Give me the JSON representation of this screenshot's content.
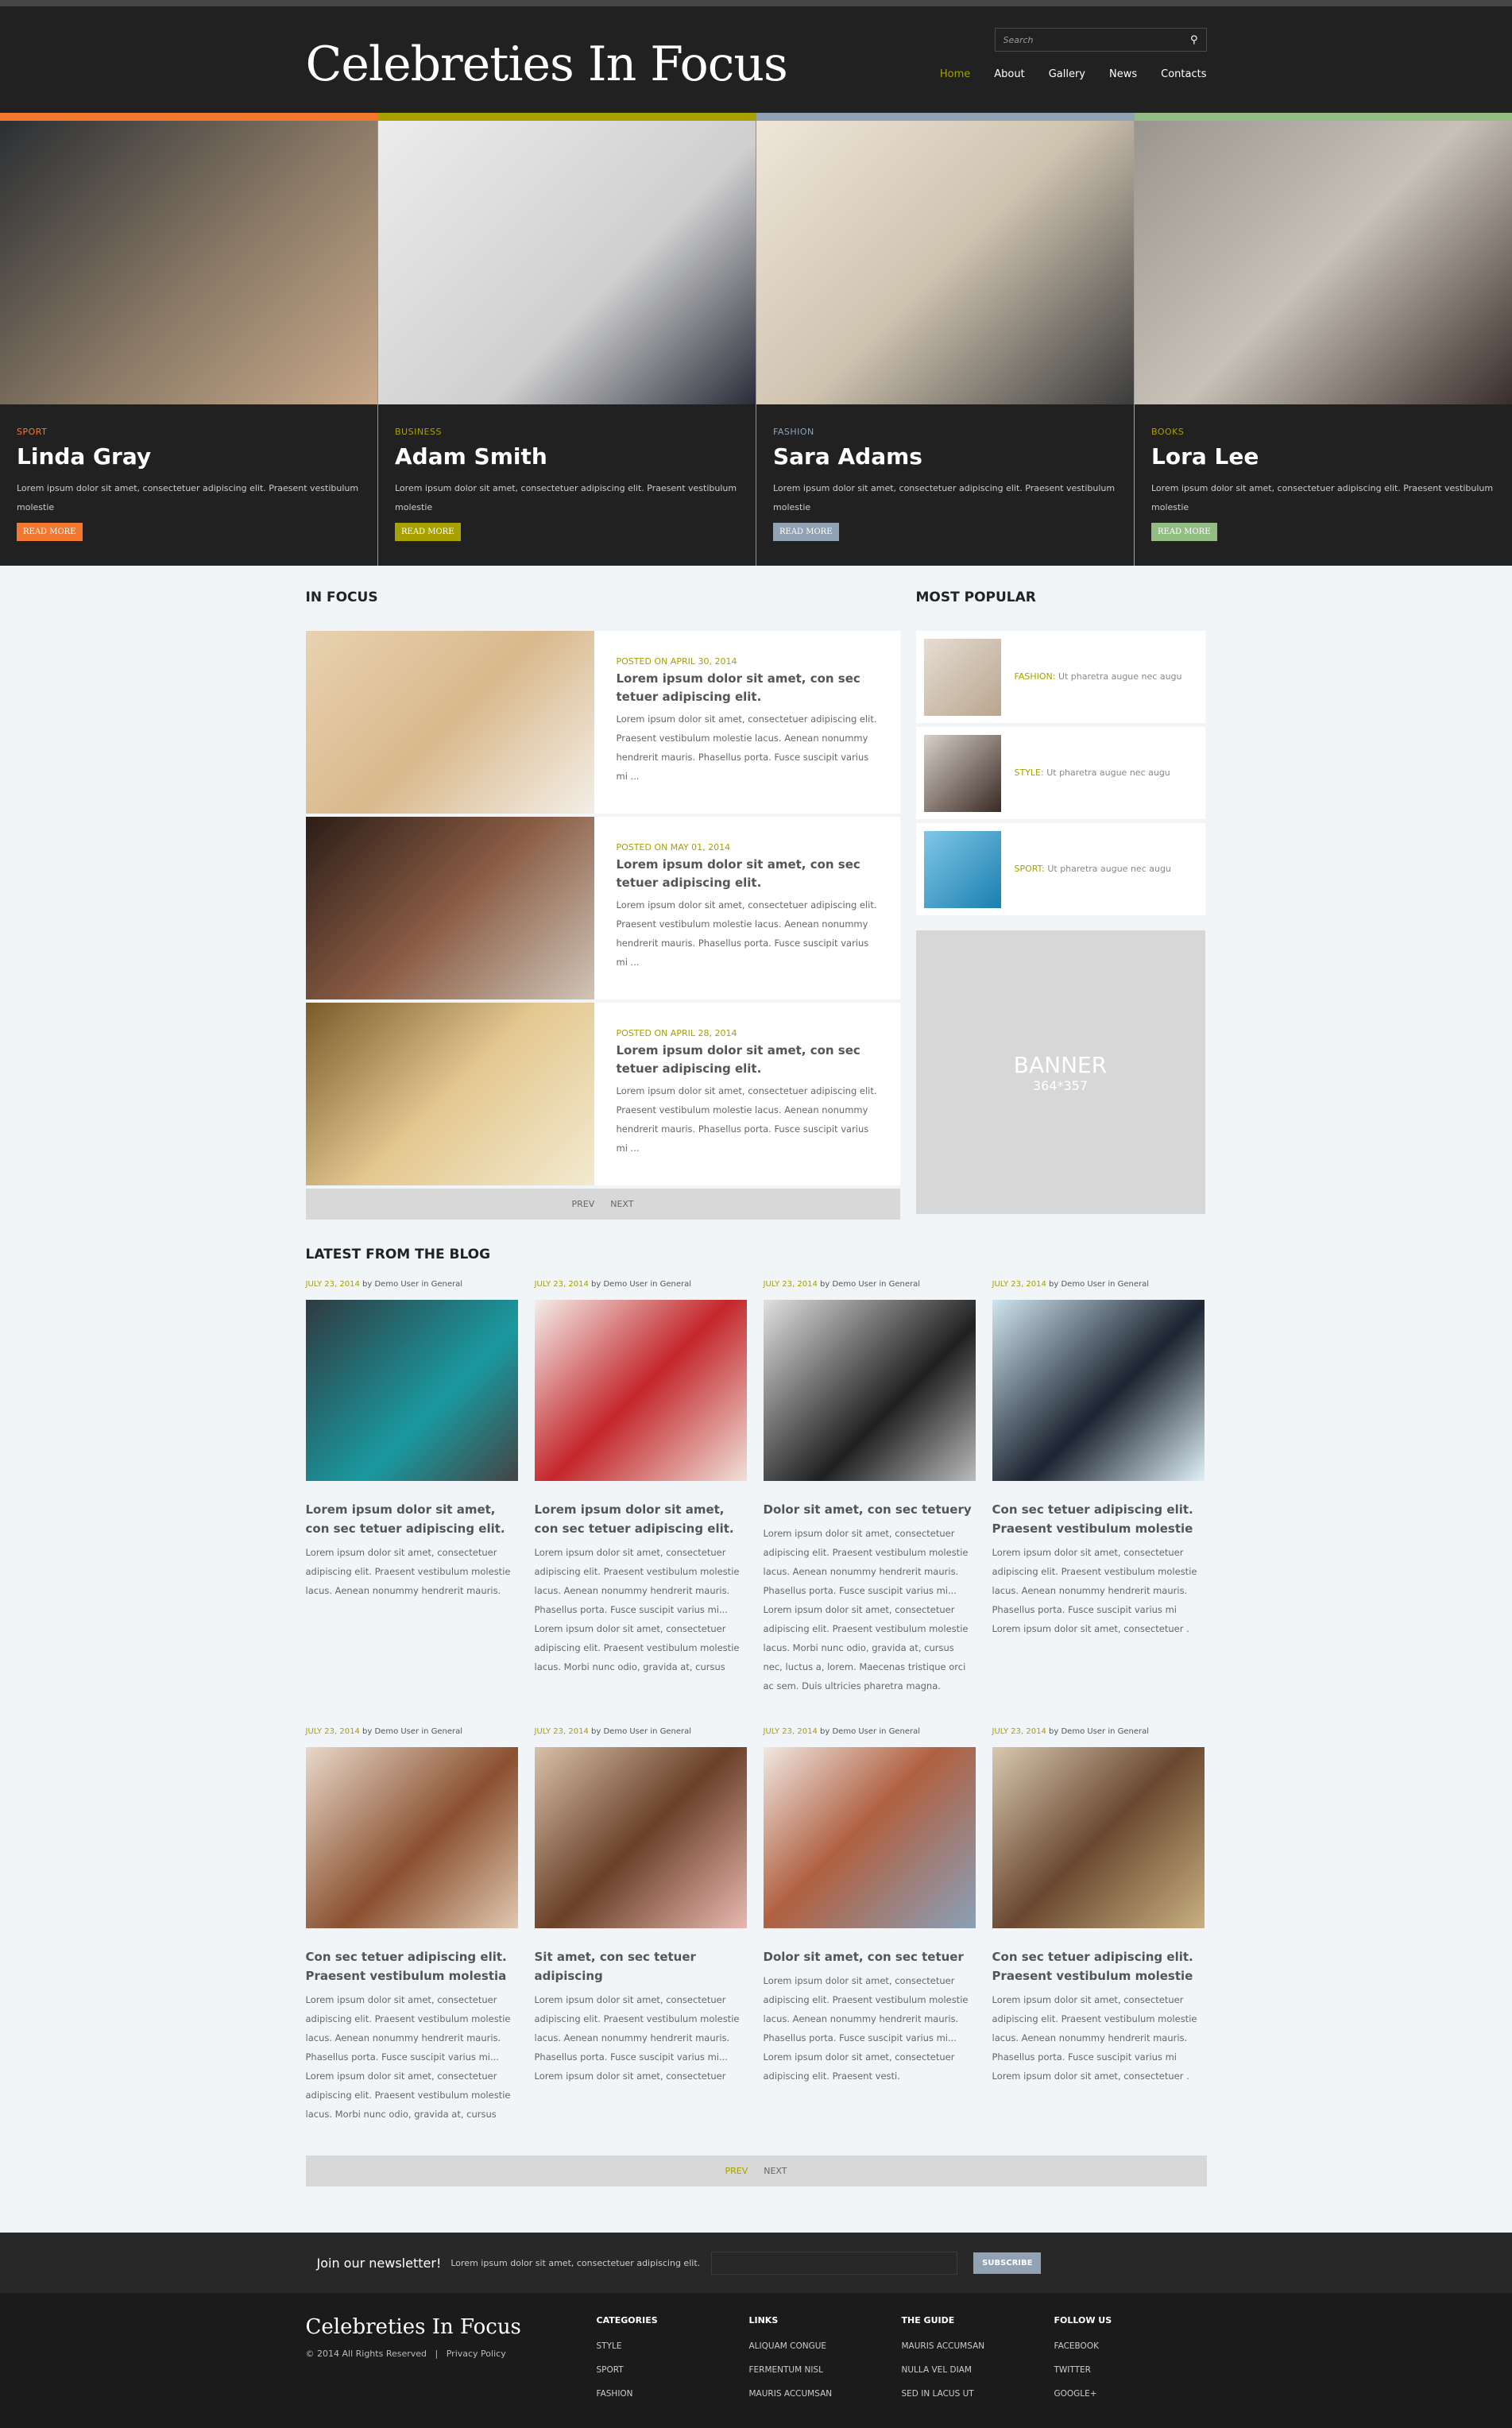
{
  "header": {
    "logo": "Celebreties In Focus",
    "search_placeholder": "Search",
    "nav": [
      "Home",
      "About",
      "Gallery",
      "News",
      "Contacts"
    ],
    "active_nav": "Home"
  },
  "slider": [
    {
      "category": "SPORT",
      "name": "Linda Gray",
      "text": "Lorem ipsum dolor sit amet, consectetuer adipiscing elit. Praesent vestibulum molestie",
      "button": "READ MORE",
      "color": "#f47730"
    },
    {
      "category": "BUSINESS",
      "name": "Adam Smith",
      "text": "Lorem ipsum dolor sit amet, consectetuer adipiscing elit. Praesent vestibulum molestie",
      "button": "READ MORE",
      "color": "#a8a200"
    },
    {
      "category": "FASHION",
      "name": "Sara Adams",
      "text": "Lorem ipsum dolor sit amet, consectetuer adipiscing elit. Praesent vestibulum molestie",
      "button": "READ MORE",
      "color": "#91a2b4"
    },
    {
      "category": "BOOKS",
      "name": "Lora Lee",
      "text": "Lorem ipsum dolor sit amet, consectetuer adipiscing elit. Praesent vestibulum molestie",
      "button": "READ MORE",
      "color": "#93bd85"
    }
  ],
  "in_focus": {
    "title": "IN FOCUS",
    "items": [
      {
        "date": "POSTED ON APRIL 30, 2014",
        "title": "Lorem ipsum dolor sit amet, con sec tetuer adipiscing elit.",
        "text": "Lorem ipsum dolor sit amet, consectetuer adipiscing elit. Praesent vestibulum molestie lacus. Aenean nonummy hendrerit mauris. Phasellus porta. Fusce suscipit varius mi ..."
      },
      {
        "date": "POSTED ON MAY 01, 2014",
        "title": "Lorem ipsum dolor sit amet, con sec tetuer adipiscing elit.",
        "text": "Lorem ipsum dolor sit amet, consectetuer adipiscing elit. Praesent vestibulum molestie lacus. Aenean nonummy hendrerit mauris. Phasellus porta. Fusce suscipit varius mi ..."
      },
      {
        "date": "POSTED ON APRIL 28, 2014",
        "title": "Lorem ipsum dolor sit amet, con sec tetuer adipiscing elit.",
        "text": "Lorem ipsum dolor sit amet, consectetuer adipiscing elit. Praesent vestibulum molestie lacus. Aenean nonummy hendrerit mauris. Phasellus porta. Fusce suscipit varius mi ..."
      }
    ],
    "prev": "PREV",
    "next": "NEXT"
  },
  "most_popular": {
    "title": "MOST POPULAR",
    "items": [
      {
        "category": "FASHION:",
        "text": "Ut pharetra augue nec augu"
      },
      {
        "category": "STYLE:",
        "text": "Ut pharetra augue nec augu"
      },
      {
        "category": "SPORT:",
        "text": "Ut pharetra augue nec augu"
      }
    ],
    "banner_title": "BANNER",
    "banner_size": "364*357"
  },
  "blog": {
    "title": "LATEST FROM THE BLOG",
    "meta_date": "JULY 23, 2014",
    "meta_rest": "by Demo User in General",
    "posts": [
      {
        "title": "Lorem ipsum dolor sit amet, con sec tetuer adipiscing elit.",
        "text": "Lorem ipsum dolor sit amet, consectetuer adipiscing elit. Praesent vestibulum molestie lacus. Aenean nonummy hendrerit mauris."
      },
      {
        "title": "Lorem ipsum dolor sit amet, con sec tetuer adipiscing elit.",
        "text": "Lorem ipsum dolor sit amet, consectetuer adipiscing elit. Praesent vestibulum molestie lacus. Aenean nonummy hendrerit mauris. Phasellus porta. Fusce suscipit varius mi... Lorem ipsum dolor sit amet, consectetuer adipiscing elit. Praesent vestibulum molestie lacus. Morbi nunc odio, gravida at, cursus"
      },
      {
        "title": "Dolor sit amet, con sec tetuery",
        "text": "Lorem ipsum dolor sit amet, consectetuer adipiscing elit. Praesent vestibulum molestie lacus. Aenean nonummy hendrerit mauris. Phasellus porta. Fusce suscipit varius mi... Lorem ipsum dolor sit amet, consectetuer adipiscing elit. Praesent vestibulum molestie lacus. Morbi nunc odio, gravida at, cursus nec, luctus a, lorem. Maecenas tristique orci ac sem. Duis ultricies pharetra magna."
      },
      {
        "title": "Con sec tetuer adipiscing elit. Praesent vestibulum molestie",
        "text": "Lorem ipsum dolor sit amet, consectetuer adipiscing elit. Praesent vestibulum molestie lacus. Aenean nonummy hendrerit mauris. Phasellus porta. Fusce suscipit varius mi Lorem ipsum dolor sit amet, consectetuer ."
      },
      {
        "title": "Con sec tetuer adipiscing elit. Praesent vestibulum molestia",
        "text": "Lorem ipsum dolor sit amet, consectetuer adipiscing elit. Praesent vestibulum molestie lacus. Aenean nonummy hendrerit mauris. Phasellus porta. Fusce suscipit varius mi... Lorem ipsum dolor sit amet, consectetuer adipiscing elit. Praesent vestibulum molestie lacus. Morbi nunc odio, gravida at, cursus"
      },
      {
        "title": "Sit amet, con sec tetuer adipiscing",
        "text": "Lorem ipsum dolor sit amet, consectetuer adipiscing elit. Praesent vestibulum molestie lacus. Aenean nonummy hendrerit mauris. Phasellus porta. Fusce suscipit varius mi... Lorem ipsum dolor sit amet, consectetuer"
      },
      {
        "title": "Dolor sit amet, con sec tetuer",
        "text": "Lorem ipsum dolor sit amet, consectetuer adipiscing elit. Praesent vestibulum molestie lacus. Aenean nonummy hendrerit mauris. Phasellus porta. Fusce suscipit varius mi... Lorem ipsum dolor sit amet, consectetuer adipiscing elit. Praesent vesti."
      },
      {
        "title": "Con sec tetuer adipiscing elit. Praesent vestibulum molestie",
        "text": "Lorem ipsum dolor sit amet, consectetuer adipiscing elit. Praesent vestibulum molestie lacus. Aenean nonummy hendrerit mauris. Phasellus porta. Fusce suscipit varius mi Lorem ipsum dolor sit amet, consectetuer ."
      }
    ],
    "prev": "PREV",
    "next": "NEXT"
  },
  "newsletter": {
    "label": "Join our newsletter!",
    "desc": "Lorem ipsum dolor sit amet, consectetuer adipiscing elit.",
    "button": "SUBSCRIBE"
  },
  "footer": {
    "brand": "Celebreties In Focus",
    "copyright": "© 2014 All Rights Reserved",
    "separator": "|",
    "privacy": "Privacy Policy",
    "columns": [
      {
        "title": "CATEGORIES",
        "links": [
          "STYLE",
          "SPORT",
          "FASHION"
        ]
      },
      {
        "title": "LINKS",
        "links": [
          "ALIQUAM CONGUE",
          "FERMENTUM NISL",
          "MAURIS ACCUMSAN"
        ]
      },
      {
        "title": "THE GUIDE",
        "links": [
          "MAURIS ACCUMSAN",
          "NULLA VEL DIAM",
          "SED IN LACUS UT"
        ]
      },
      {
        "title": "FOLLOW US",
        "links": [
          "FACEBOOK",
          "TWITTER",
          "GOOGLE+"
        ]
      }
    ]
  },
  "colors": {
    "accent": "#a6a000",
    "header_bg": "#212121",
    "page_bg": "#f1f5f7"
  }
}
